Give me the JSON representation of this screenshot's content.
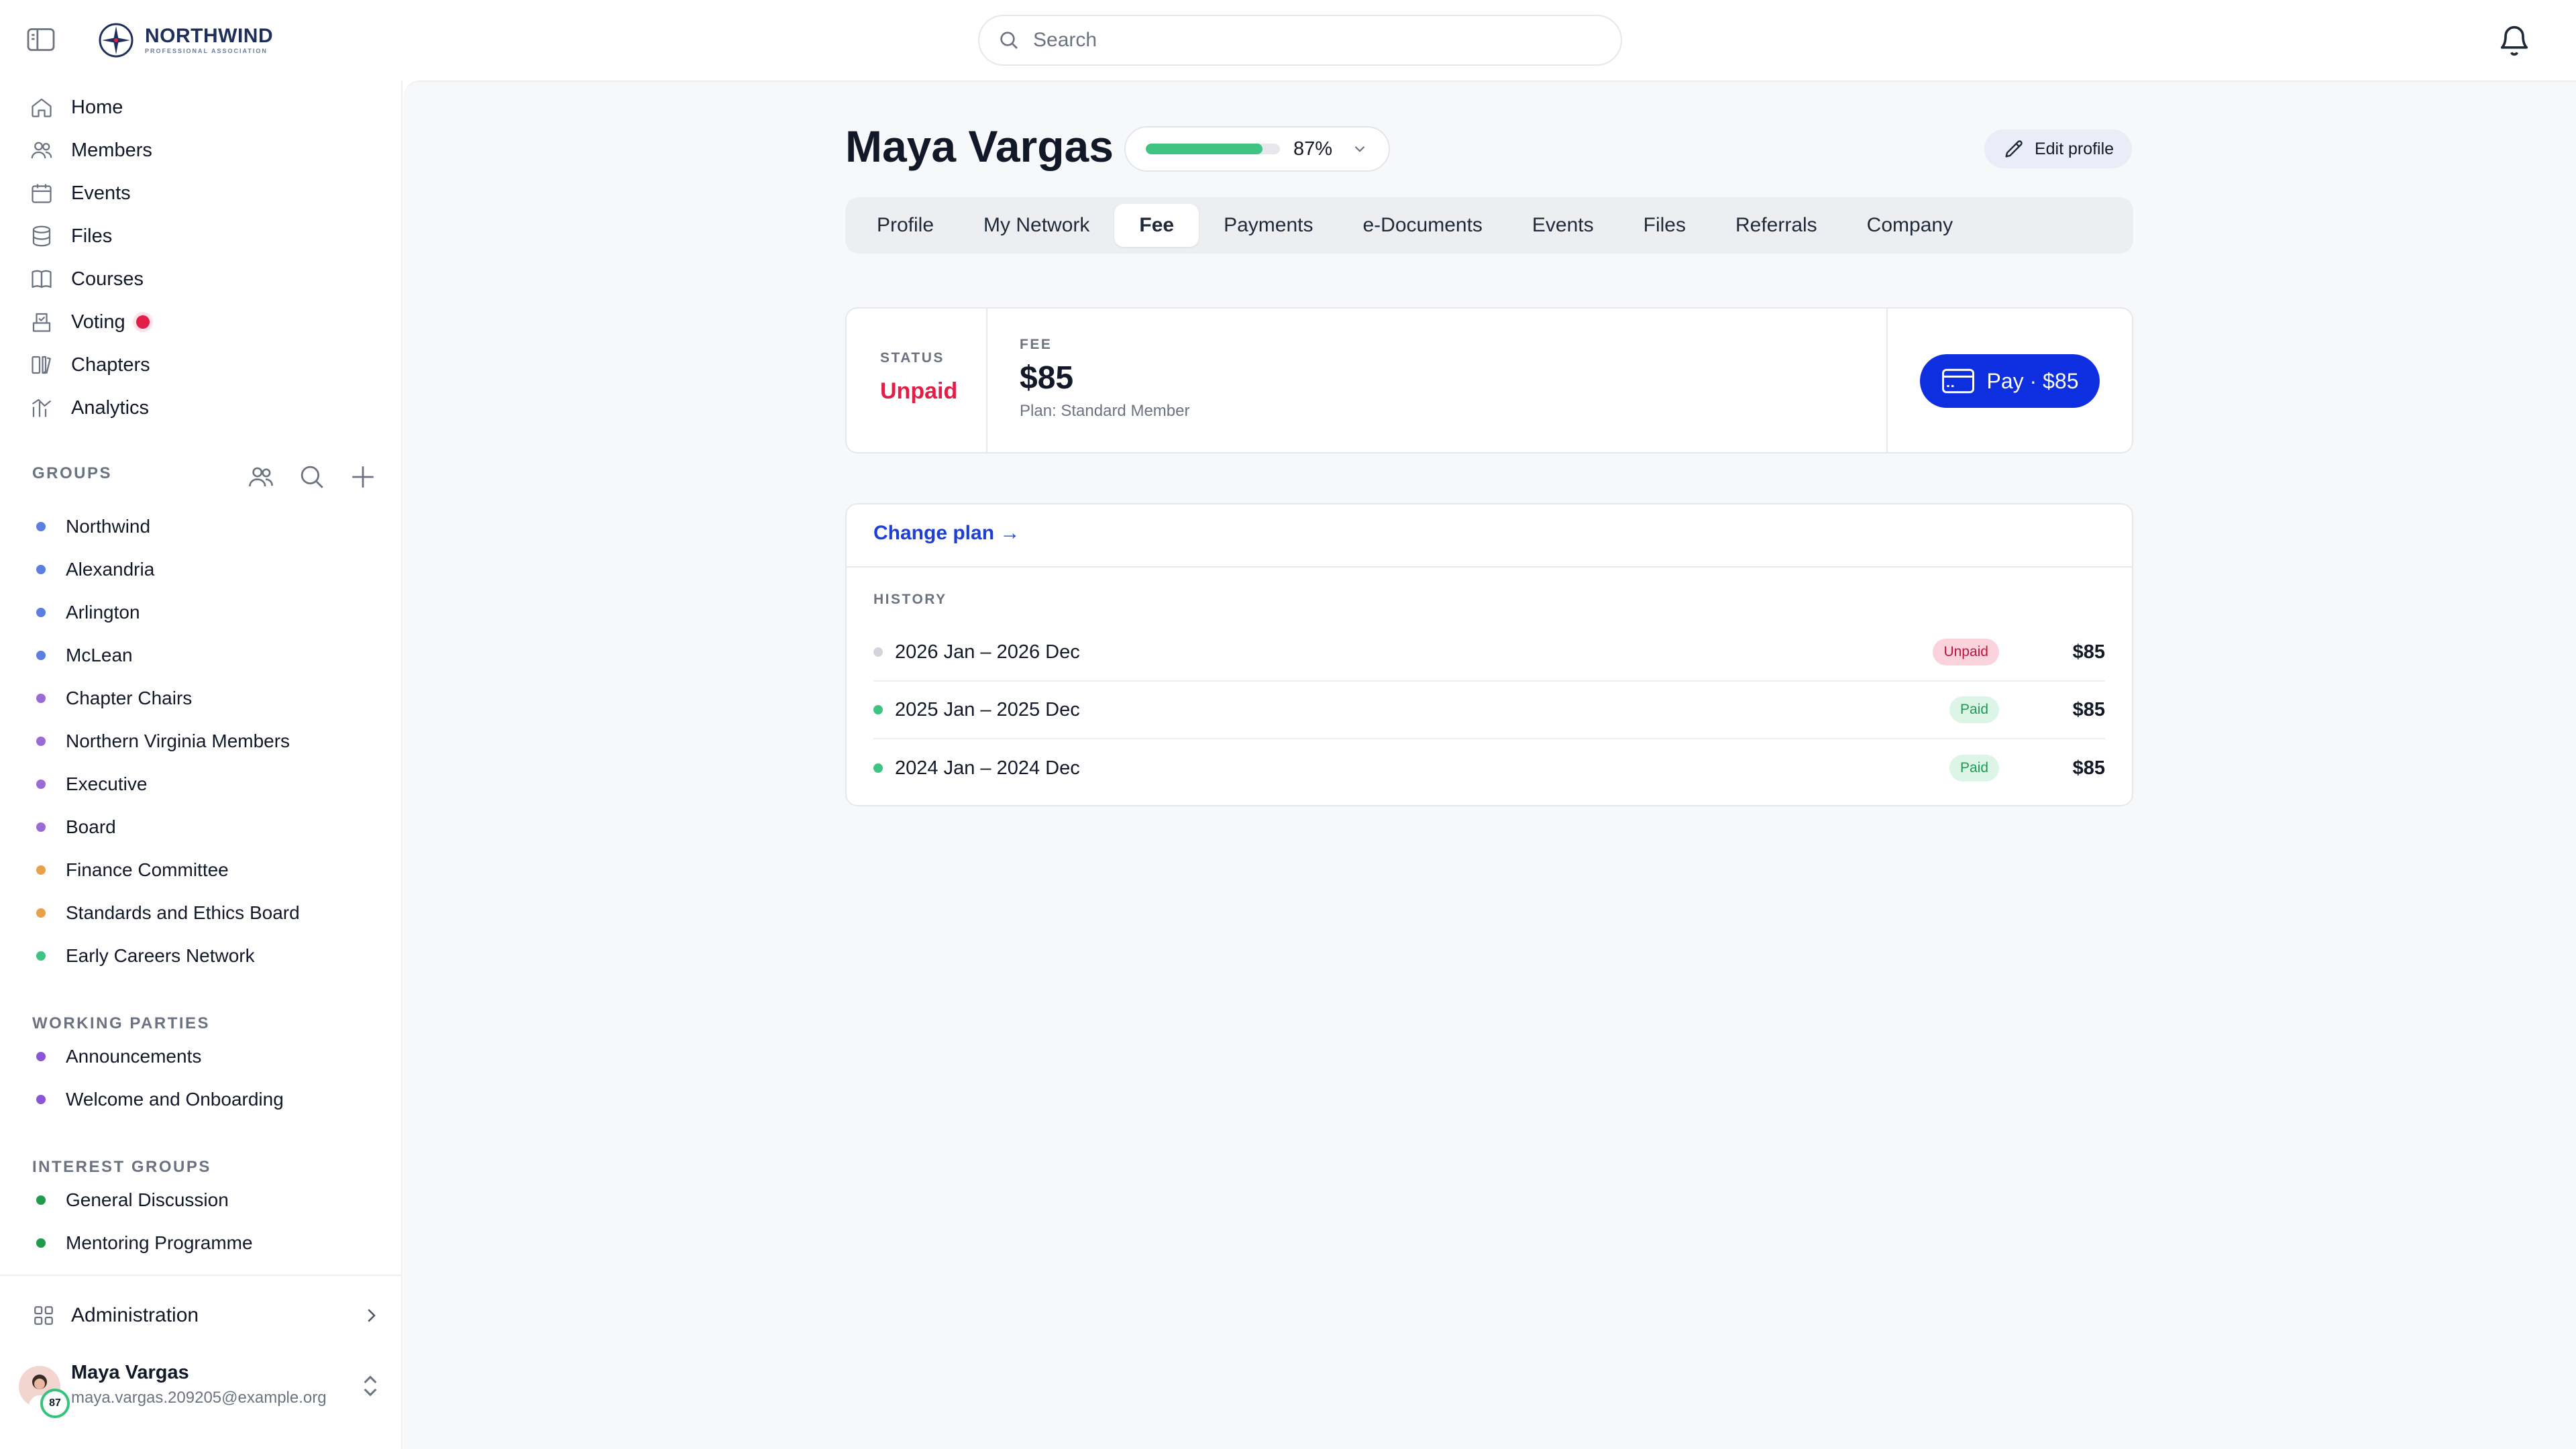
{
  "app": {
    "logo_title": "NORTHWIND",
    "logo_subtitle": "PROFESSIONAL ASSOCIATION"
  },
  "search": {
    "placeholder": "Search",
    "value": ""
  },
  "sidebar": {
    "nav": [
      {
        "label": "Home",
        "icon": "home-icon"
      },
      {
        "label": "Members",
        "icon": "members-icon"
      },
      {
        "label": "Events",
        "icon": "calendar-icon"
      },
      {
        "label": "Files",
        "icon": "database-icon"
      },
      {
        "label": "Courses",
        "icon": "book-icon"
      },
      {
        "label": "Voting",
        "icon": "ballot-icon",
        "has_alert": true
      },
      {
        "label": "Chapters",
        "icon": "chapters-icon"
      },
      {
        "label": "Analytics",
        "icon": "analytics-icon"
      }
    ],
    "groups_label": "GROUPS",
    "groups": [
      {
        "label": "Northwind",
        "color": "#5b7fdc"
      },
      {
        "label": "Alexandria",
        "color": "#5b7fdc"
      },
      {
        "label": "Arlington",
        "color": "#5b7fdc"
      },
      {
        "label": "McLean",
        "color": "#5b7fdc"
      },
      {
        "label": "Chapter Chairs",
        "color": "#9a6ad6"
      },
      {
        "label": "Northern Virginia Members",
        "color": "#9a6ad6"
      },
      {
        "label": "Executive",
        "color": "#9a6ad6"
      },
      {
        "label": "Board",
        "color": "#9a6ad6"
      },
      {
        "label": "Finance Committee",
        "color": "#e8a04a"
      },
      {
        "label": "Standards and Ethics Board",
        "color": "#e8a04a"
      },
      {
        "label": "Early Careers Network",
        "color": "#3fc383"
      }
    ],
    "working_parties_label": "WORKING PARTIES",
    "working_parties": [
      {
        "label": "Announcements",
        "color": "#8a55d6"
      },
      {
        "label": "Welcome and Onboarding",
        "color": "#8a55d6"
      }
    ],
    "interest_groups_label": "INTEREST GROUPS",
    "interest_groups": [
      {
        "label": "General Discussion",
        "color": "#1f9a4a"
      },
      {
        "label": "Mentoring Programme",
        "color": "#1f9a4a"
      }
    ],
    "administration_label": "Administration",
    "user": {
      "name": "Maya Vargas",
      "email": "maya.vargas.209205@example.org",
      "score": "87"
    }
  },
  "profile": {
    "name": "Maya Vargas",
    "completion_pct": 87,
    "completion_label": "87%",
    "edit_label": "Edit profile",
    "tabs": [
      "Profile",
      "My Network",
      "Fee",
      "Payments",
      "e-Documents",
      "Events",
      "Files",
      "Referrals",
      "Company"
    ],
    "active_tab": "Fee"
  },
  "fee": {
    "status_label": "STATUS",
    "status_value": "Unpaid",
    "fee_label": "FEE",
    "fee_value": "$85",
    "plan_text": "Plan: Standard Member",
    "pay_label": "Pay · $85",
    "change_plan_label": "Change plan →",
    "history_label": "HISTORY",
    "history": [
      {
        "period": "2026 Jan – 2026 Dec",
        "status": "Unpaid",
        "amount": "$85",
        "dot_color": "#d1d5db"
      },
      {
        "period": "2025 Jan – 2025 Dec",
        "status": "Paid",
        "amount": "$85",
        "dot_color": "#3fc383"
      },
      {
        "period": "2024 Jan – 2024 Dec",
        "status": "Paid",
        "amount": "$85",
        "dot_color": "#3fc383"
      }
    ]
  },
  "colors": {
    "accent": "#0d2fe0",
    "link": "#1d3fd8",
    "unpaid": "#e11d48",
    "paid": "#1f9a55",
    "progress": "#3fc383"
  }
}
